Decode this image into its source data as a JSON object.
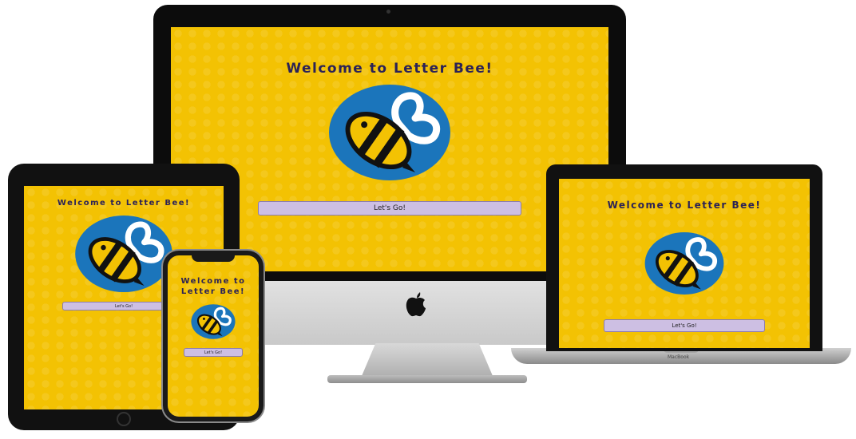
{
  "app": {
    "welcome_title": "Welcome to Letter Bee!",
    "welcome_title_line1": "Welcome to",
    "welcome_title_line2": "Letter Bee!",
    "start_button_label": "Let's Go!",
    "laptop_brand": "MacBook"
  },
  "colors": {
    "background_yellow": "#f3c203",
    "title_navy": "#2b2257",
    "logo_blue": "#1b75bb",
    "button_lavender": "#cdbfe3"
  },
  "icons": {
    "logo": "bee-logo-icon",
    "apple": "apple-logo-icon"
  }
}
